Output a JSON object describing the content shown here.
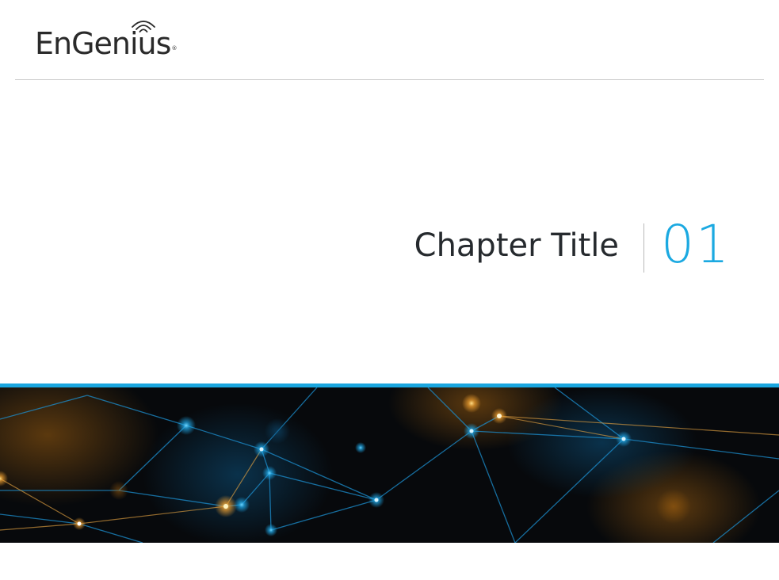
{
  "brand": {
    "name": "EnGenius",
    "registered_mark": "®",
    "text_color": "#2a2a2a"
  },
  "chapter": {
    "title": "Chapter Title",
    "number": "01",
    "number_color": "#1ba9e1"
  },
  "banner": {
    "accent_color": "#1aa6df",
    "background_color": "#07090c",
    "node_colors": [
      "#2bb8f0",
      "#f0a830",
      "#fff4c8"
    ]
  }
}
